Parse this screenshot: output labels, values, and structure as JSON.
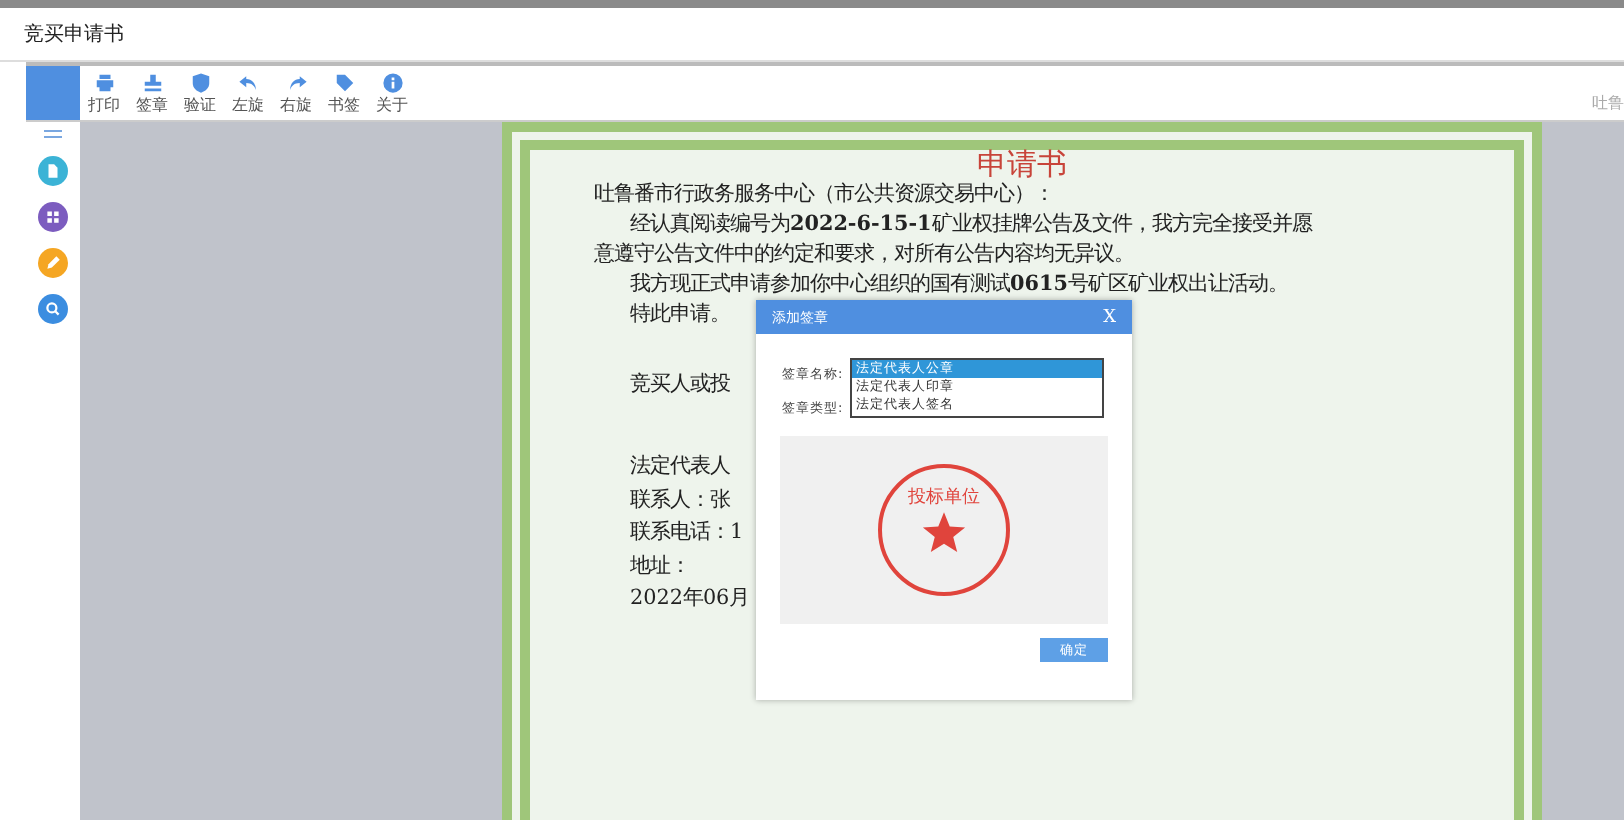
{
  "window": {
    "title": "竞买申请书"
  },
  "toolbar": {
    "items": [
      {
        "label": "打印",
        "kind": "print"
      },
      {
        "label": "签章",
        "kind": "stamp"
      },
      {
        "label": "验证",
        "kind": "verify"
      },
      {
        "label": "左旋",
        "kind": "left"
      },
      {
        "label": "右旋",
        "kind": "right"
      },
      {
        "label": "书签",
        "kind": "bookmark"
      },
      {
        "label": "关于",
        "kind": "about"
      }
    ],
    "right_text": "吐鲁"
  },
  "sidebar": {
    "items": [
      {
        "kind": "file",
        "color": "#3bb3d6"
      },
      {
        "kind": "grid",
        "color": "#7c5cbf"
      },
      {
        "kind": "pen",
        "color": "#f5a623"
      },
      {
        "kind": "search",
        "color": "#3b8de0"
      }
    ]
  },
  "document": {
    "title": "申请书",
    "salutation": "吐鲁番市行政务服务中心（市公共资源交易中心）：",
    "paragraphs": [
      [
        "经认真阅读编号为**2022-6-15-1**矿业权挂牌公告及文件，我方完全接受并愿",
        "意遵守公告文件中的约定和要求，对所有公告内容均无异议。"
      ],
      [
        "我方现正式申请参加你中心组织的国有测试**0615**号矿区矿业权出让活动。"
      ],
      [
        "特此申请。"
      ]
    ],
    "signature_groups": [
      [
        "竞买人或投"
      ],
      [
        "法定代表人",
        "联系人：张",
        "联系电话：1",
        "地址：",
        "2022年06月"
      ]
    ]
  },
  "dialog": {
    "title": "添加签章",
    "close": "X",
    "name_label": "签章名称:",
    "type_label": "签章类型:",
    "options": [
      {
        "label": "法定代表人公章",
        "selected": true
      },
      {
        "label": "法定代表人印章",
        "selected": false
      },
      {
        "label": "法定代表人签名",
        "selected": false
      }
    ],
    "stamp_text": "投标单位",
    "button": "确定"
  }
}
